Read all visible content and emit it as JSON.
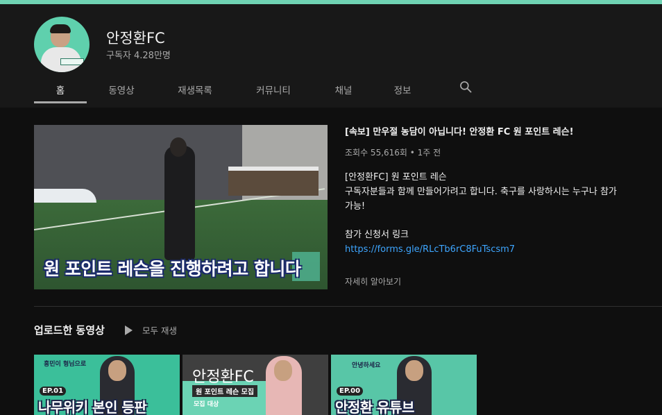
{
  "channel": {
    "name": "안정환FC",
    "subscribers": "구독자 4.28만명"
  },
  "tabs": [
    {
      "label": "홈"
    },
    {
      "label": "동영상"
    },
    {
      "label": "재생목록"
    },
    {
      "label": "커뮤니티"
    },
    {
      "label": "채널"
    },
    {
      "label": "정보"
    }
  ],
  "search": {
    "icon": "search-icon"
  },
  "featured": {
    "thumbnail_caption": "원 포인트 레슨을 진행하려고 합니다",
    "title": "[속보] 만우절 농담이 아닙니다! 안정환 FC 원 포인트 레슨!",
    "meta": "조회수 55,616회 • 1주 전",
    "description_lines": [
      "[안정환FC] 원 포인트 레슨",
      "구독자분들과 함께 만들어가려고 합니다. 축구를 사랑하시는 누구나 참가",
      "가능!"
    ],
    "signup_label": "참가 신청서 링크",
    "link": "https://forms.gle/RLcTb6rC8FuTscsm7",
    "more": "자세히 알아보기"
  },
  "uploads": {
    "title": "업로드한 동영상",
    "play_all": "모두 재생",
    "thumbnails": [
      {
        "ep": "EP.01",
        "big_text": "나무위키 본인 등판",
        "small_text": "흥민이 형님으로"
      },
      {
        "brand": "안정환FC",
        "sub": "원 포인트 레슨 모집",
        "small_text": "모집 대상"
      },
      {
        "ep": "EP.00",
        "big_text": "안정환 유튜브",
        "small_text": "안녕하세요"
      }
    ]
  },
  "colors": {
    "banner": "#6fd3b3",
    "link": "#3ea6ff",
    "background": "#0f0f0f",
    "header": "#181818"
  }
}
